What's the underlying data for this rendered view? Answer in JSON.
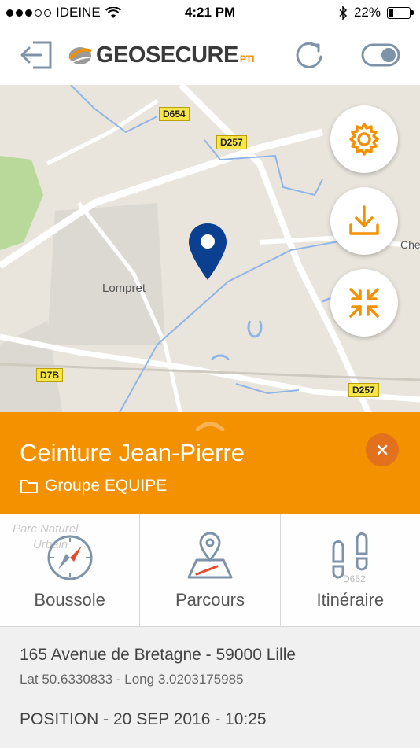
{
  "status_bar": {
    "carrier": "IDEINE",
    "time": "4:21 PM",
    "battery": "22%",
    "battery_level": 0.22
  },
  "header": {
    "brand": "GEOSECURE",
    "brand_suffix": "PTI"
  },
  "map": {
    "places": {
      "lompret": "Lompret",
      "che": "Che"
    },
    "roads": {
      "d654": "D654",
      "d257_top": "D257",
      "d7b": "D7B",
      "d257_bottom": "D257",
      "d652": "D652"
    },
    "background_labels": {
      "parc_naturel": "Parc Naturel",
      "urbain": "Urbain"
    }
  },
  "device_panel": {
    "name": "Ceinture Jean-Pierre",
    "group": "Groupe EQUIPE"
  },
  "actions": [
    {
      "label": "Boussole",
      "icon": "compass-icon"
    },
    {
      "label": "Parcours",
      "icon": "map-route-icon"
    },
    {
      "label": "Itinéraire",
      "icon": "footsteps-icon"
    }
  ],
  "info": {
    "address": "165 Avenue de Bretagne - 59000 Lille",
    "coordinates": "Lat 50.6330833 - Long 3.0203175985",
    "position": "POSITION - 20 SEP 2016 - 10:25"
  },
  "colors": {
    "accent": "#f39100",
    "pin": "#0b3f8f",
    "close_bg": "#e2701d"
  }
}
